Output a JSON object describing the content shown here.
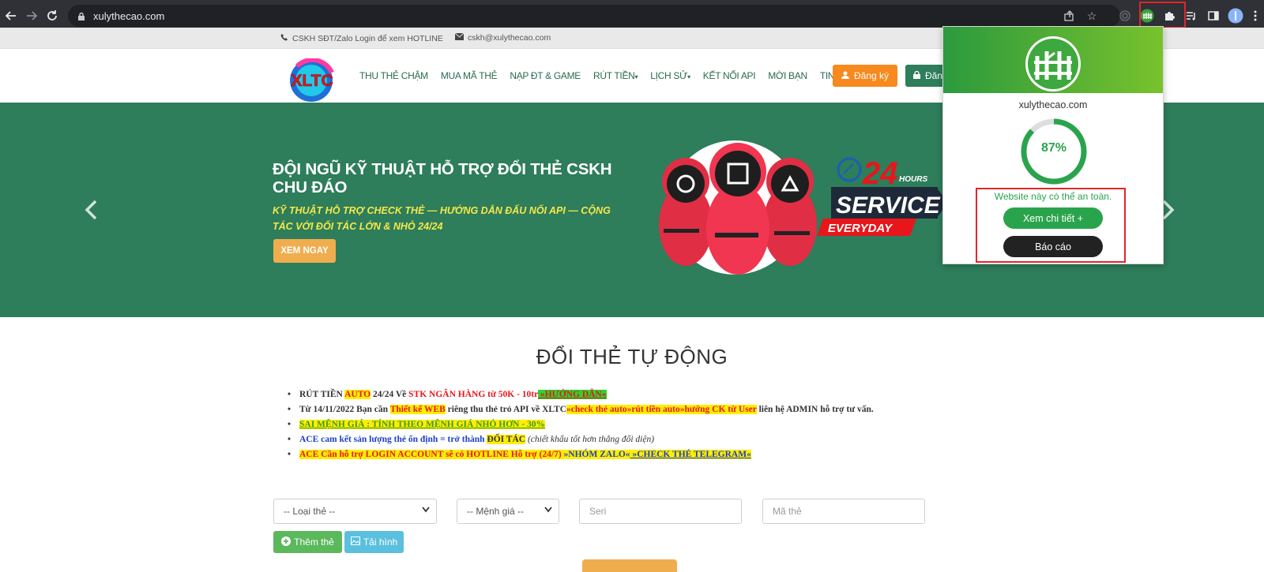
{
  "browser": {
    "url": "xulythecao.com",
    "accent": "#e0262a"
  },
  "infobar": {
    "phone": "CSKH SĐT/Zalo Login để xem HOTLINE",
    "email": "cskh@xulythecao.com"
  },
  "nav": {
    "logo_text": "XLTC",
    "items": [
      "THU THẺ CHẬM",
      "MUA MÃ THẺ",
      "NẠP ĐT & GAME",
      "RÚT TIỀN",
      "LỊCH SỬ",
      "KẾT NỐI API",
      "MỜI BẠN",
      "TIN TỨC"
    ],
    "register": "Đăng ký",
    "login": "Đăng"
  },
  "hero": {
    "title": "ĐỘI NGŨ KỸ THUẬT HỖ TRỢ ĐỔI THẺ CSKH CHU ĐÁO",
    "subtitle": "KỸ THUẬT HỖ TRỢ CHECK THẺ — HƯỚNG DẪN ĐẤU NỐI API — CỘNG TÁC VỚI ĐỐI TÁC LỚN & NHỎ 24/24",
    "button": "XEM NGAY",
    "badge_24": "24",
    "badge_hours": "HOURS",
    "badge_service": "SERVICE",
    "badge_everyday": "EVERYDAY",
    "bg": "#2e7d5b"
  },
  "section": {
    "title": "ĐỔI THẺ TỰ ĐỘNG"
  },
  "notes": {
    "n1_a": "RÚT TIỀN ",
    "n1_b": "AUTO",
    "n1_c": " 24/24 Về ",
    "n1_d": "STK NGÂN HÀNG từ 50K - 10tr",
    "n1_e": " »HƯỚNG DẪN«",
    "n2_a": "Từ 14/11/2022 Bạn cần ",
    "n2_b": "Thiết kế WEB",
    "n2_c": " riêng thu thẻ trỏ API về XLTC",
    "n2_d": "»check thẻ auto»rút tiền auto»hướng CK từ User",
    "n2_e": " liên hệ ADMIN hỗ trợ tư vấn.",
    "n3": "SAI MỆNH GIÁ : TÍNH THEO MỆNH GIÁ NHỎ HƠN - 30%",
    "n4_a": "ACE cam kết sản lượng thẻ ổn định = trở thành ",
    "n4_b": "ĐỐI TÁC",
    "n4_c": " (chiết khấu tốt hơn thẳng đối diện)",
    "n5_a": "ACE Cần hỗ trợ LOGIN ACCOUNT sẽ có HOTLINE Hỗ trợ (24/7) ",
    "n5_b": "»NHÓM ZALO«",
    "n5_c": " »CHECK THẺ TELEGRAM«"
  },
  "form": {
    "card_type": "-- Loại thẻ --",
    "denomination": "-- Mệnh giá --",
    "serial_placeholder": "Seri",
    "code_placeholder": "Mã thẻ",
    "add_button": "Thêm thẻ",
    "upload_button": "Tải hình"
  },
  "popup": {
    "domain": "xulythecao.com",
    "score": "87%",
    "score_value": 87,
    "safe_text": "Website này có thể an toàn.",
    "detail_button": "Xem chi tiết +",
    "report_button": "Báo cáo",
    "accent": "#2aa44c"
  }
}
